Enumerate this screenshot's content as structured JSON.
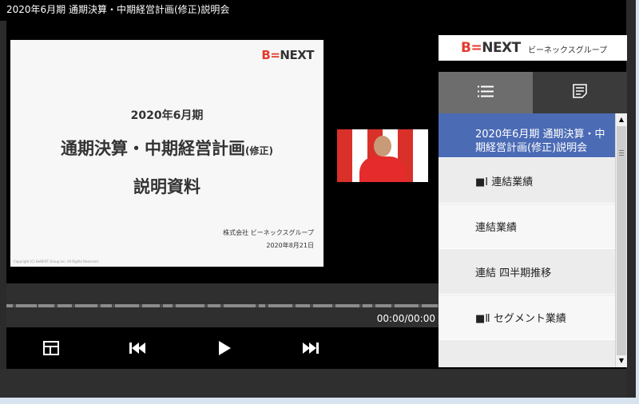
{
  "window": {
    "title": "2020年6月期 通期決算・中期経営計画(修正)説明会"
  },
  "slide": {
    "logo_b": "B",
    "logo_rest": "NEXT",
    "line1": "2020年6月期",
    "line2_main": "通期決算・中期経営計画",
    "line2_small": "(修正)",
    "line3": "説明資料",
    "company": "株式会社 ビーネックスグループ",
    "date": "2020年8月21日",
    "copyright": "Copyright (C) BeNEXT Group Inc. All Rights Reserved."
  },
  "player": {
    "time": "00:00/00:00",
    "icons": {
      "layout": "layout-icon",
      "prev": "skip-back-icon",
      "play": "play-icon",
      "next": "skip-forward-icon"
    }
  },
  "sidebar": {
    "logo_b": "B",
    "logo_rest": "NEXT",
    "logo_sub": "ビーネックスグループ",
    "tabs": [
      {
        "icon": "list-icon",
        "active": true
      },
      {
        "icon": "notes-icon",
        "active": false
      }
    ],
    "items": [
      {
        "label": "2020年6月期 通期決算・中期経営計画(修正)説明会"
      },
      {
        "label": "■Ⅰ 連結業績"
      },
      {
        "label": "連結業績"
      },
      {
        "label": "連結 四半期推移"
      },
      {
        "label": "■Ⅱ セグメント業績"
      },
      {
        "label": ""
      }
    ]
  },
  "colors": {
    "accent": "#4b6bb5",
    "brand_red": "#e23a2b"
  }
}
